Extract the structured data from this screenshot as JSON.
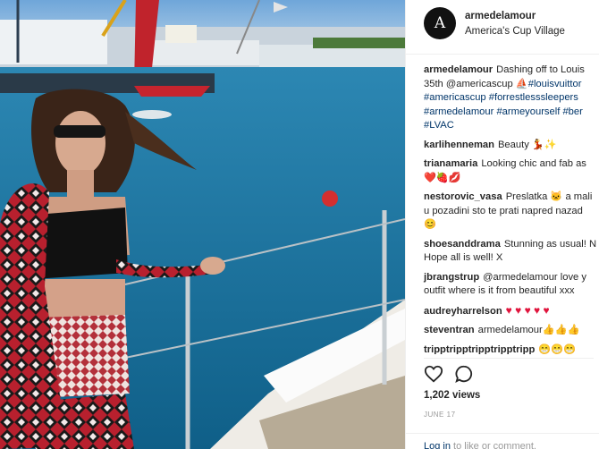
{
  "post": {
    "username": "armedelamour",
    "avatar_letter": "A",
    "location": "America's Cup Village",
    "caption": {
      "user": "armedelamour",
      "lines": [
        "Dashing off to Louis",
        "35th @americascup",
        "#americascup #forrestlesssleepers",
        "#armedelamour #armeyourself #ber",
        "#LVAC"
      ],
      "line2_tag": "#louisvuittor"
    },
    "comments": [
      {
        "user": "karlihenneman",
        "text": "Beauty",
        "emoji": "💃✨"
      },
      {
        "user": "trianamaria",
        "text": "Looking chic and fab as",
        "line2_emoji": "❤️🍓💋"
      },
      {
        "user": "nestorovic_vasa",
        "text": "Preslatka 🐱 a mali",
        "line2": "u pozadini sto te prati napred nazad",
        "line3_emoji": "😊"
      },
      {
        "user": "shoesanddrama",
        "text": "Stunning as usual! N",
        "line2": "Hope all is well! X"
      },
      {
        "user": "jbrangstrup",
        "text": "@armedelamour love y",
        "line2": "outfit where is it from beautiful xxx"
      },
      {
        "user": "audreyharrelson",
        "text": "",
        "hearts": "♥ ♥ ♥ ♥ ♥"
      },
      {
        "user": "steventran",
        "text": "armedelamour👍👍👍"
      },
      {
        "user": "tripptripptripptripptripp",
        "text": "😁😁😁"
      }
    ],
    "views": "1,202 views",
    "date": "JUNE 17",
    "login": {
      "link": "Log in",
      "text": "to like or comment."
    }
  },
  "colors": {
    "sea": "#1b6f9a",
    "link": "#003569",
    "text": "#262626"
  }
}
